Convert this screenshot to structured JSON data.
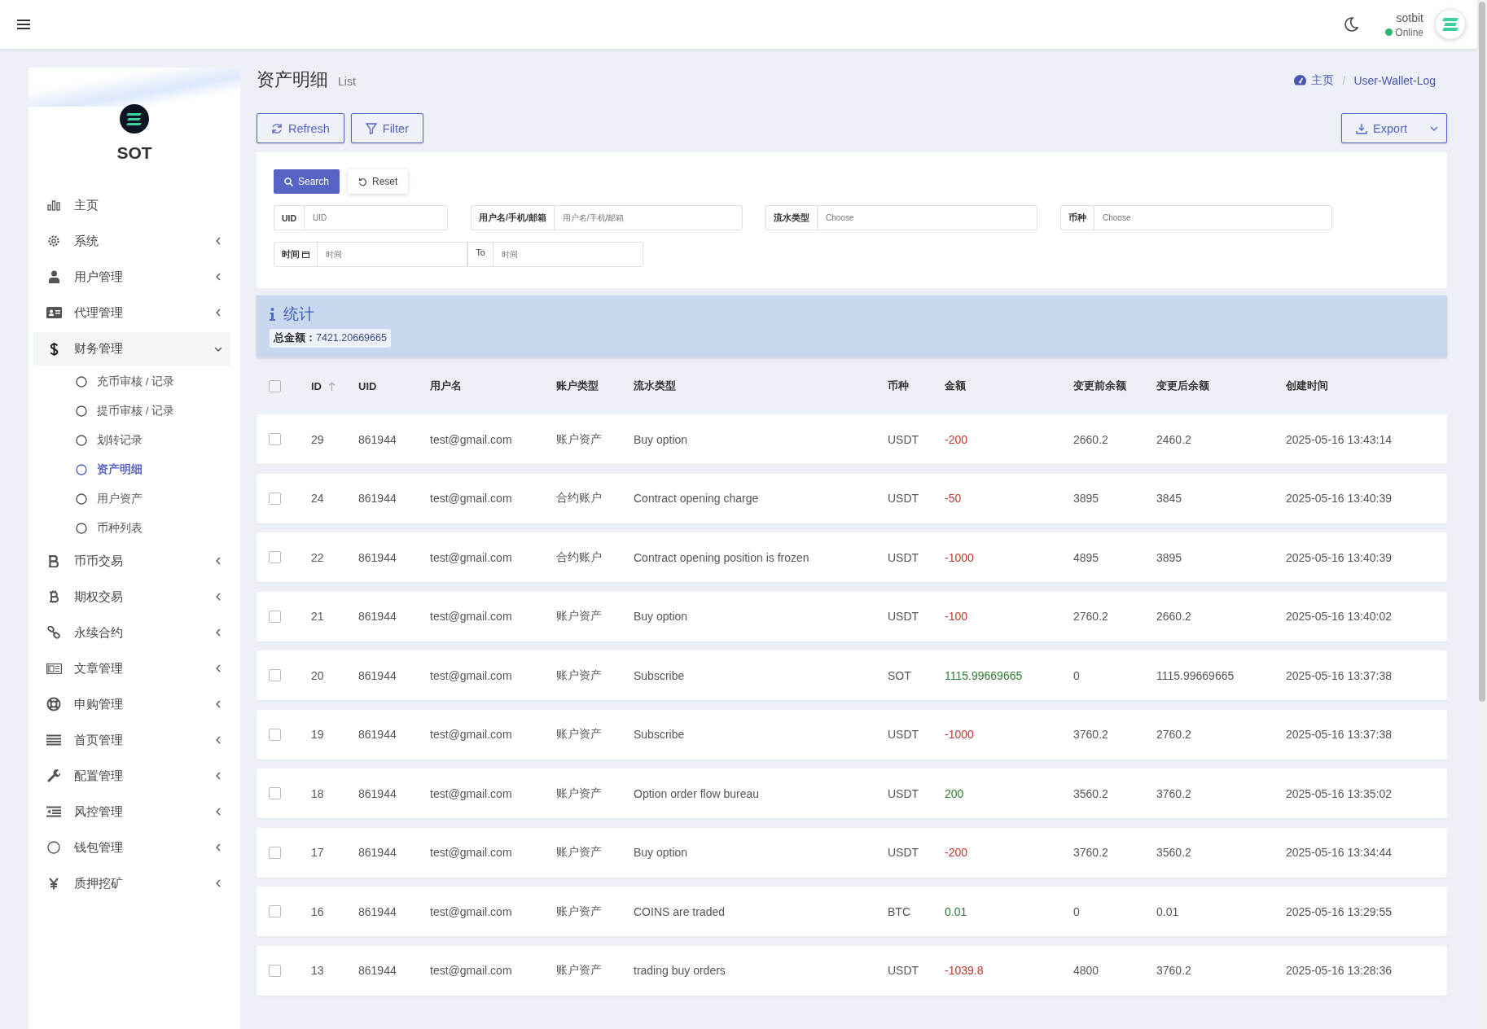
{
  "header": {
    "user": {
      "name": "sotbit",
      "status": "Online"
    }
  },
  "sidebar": {
    "brand": "SOT",
    "items": [
      {
        "label": "主页",
        "expanded": false
      },
      {
        "label": "系统",
        "expanded": false
      },
      {
        "label": "用户管理",
        "expanded": false
      },
      {
        "label": "代理管理",
        "expanded": false
      },
      {
        "label": "财务管理",
        "expanded": true,
        "children": [
          {
            "label": "充币审核 / 记录",
            "selected": false
          },
          {
            "label": "提币审核 / 记录",
            "selected": false
          },
          {
            "label": "划转记录",
            "selected": false
          },
          {
            "label": "资产明细",
            "selected": true
          },
          {
            "label": "用户资产",
            "selected": false
          },
          {
            "label": "币种列表",
            "selected": false
          }
        ]
      },
      {
        "label": "币币交易",
        "expanded": false
      },
      {
        "label": "期权交易",
        "expanded": false
      },
      {
        "label": "永续合约",
        "expanded": false
      },
      {
        "label": "文章管理",
        "expanded": false
      },
      {
        "label": "申购管理",
        "expanded": false
      },
      {
        "label": "首页管理",
        "expanded": false
      },
      {
        "label": "配置管理",
        "expanded": false
      },
      {
        "label": "风控管理",
        "expanded": false
      },
      {
        "label": "钱包管理",
        "expanded": false
      },
      {
        "label": "质押挖矿",
        "expanded": false
      }
    ]
  },
  "page": {
    "title": "资产明细",
    "subtitle": "List",
    "breadcrumb": [
      "主页",
      "User-Wallet-Log"
    ],
    "breadcrumb_separator": "/"
  },
  "toolbar": {
    "refresh": "Refresh",
    "filter": "Filter",
    "export": "Export"
  },
  "filter": {
    "search": "Search",
    "reset": "Reset",
    "fields": [
      {
        "label": "UID",
        "placeholder": "UID"
      },
      {
        "label": "用户名/手机/邮箱",
        "placeholder": "用户名/手机/邮箱"
      },
      {
        "label": "流水类型",
        "placeholder": "Choose"
      },
      {
        "label": "币种",
        "placeholder": "Choose"
      }
    ],
    "time": {
      "label": "时间",
      "from_placeholder": "时间",
      "to": "To",
      "to_placeholder": "时间"
    }
  },
  "stats": {
    "title": "统计",
    "total_label": "总金额：",
    "total": "7421.20669665"
  },
  "table": {
    "select_all_checked": false,
    "columns": [
      "ID",
      "UID",
      "用户名",
      "账户类型",
      "流水类型",
      "币种",
      "金额",
      "变更前余额",
      "变更后余额",
      "创建时间"
    ],
    "rows": [
      {
        "id": "29",
        "uid": "861944",
        "user": "test@gmail.com",
        "account": "账户资产",
        "type": "Buy option",
        "coin": "USDT",
        "amount": "-200",
        "color": "#c0392b",
        "before": "2660.2",
        "after": "2460.2",
        "time": "2025-05-16 13:43:14",
        "checked": false
      },
      {
        "id": "24",
        "uid": "861944",
        "user": "test@gmail.com",
        "account": "合约账户",
        "type": "Contract opening charge",
        "coin": "USDT",
        "amount": "-50",
        "color": "#c0392b",
        "before": "3895",
        "after": "3845",
        "time": "2025-05-16 13:40:39",
        "checked": false
      },
      {
        "id": "22",
        "uid": "861944",
        "user": "test@gmail.com",
        "account": "合约账户",
        "type": "Contract opening position is frozen",
        "coin": "USDT",
        "amount": "-1000",
        "color": "#c0392b",
        "before": "4895",
        "after": "3895",
        "time": "2025-05-16 13:40:39",
        "checked": false
      },
      {
        "id": "21",
        "uid": "861944",
        "user": "test@gmail.com",
        "account": "账户资产",
        "type": "Buy option",
        "coin": "USDT",
        "amount": "-100",
        "color": "#c0392b",
        "before": "2760.2",
        "after": "2660.2",
        "time": "2025-05-16 13:40:02",
        "checked": false
      },
      {
        "id": "20",
        "uid": "861944",
        "user": "test@gmail.com",
        "account": "账户资产",
        "type": "Subscribe",
        "coin": "SOT",
        "amount": "1115.99669665",
        "color": "#2e7d32",
        "before": "0",
        "after": "1115.99669665",
        "time": "2025-05-16 13:37:38",
        "checked": false
      },
      {
        "id": "19",
        "uid": "861944",
        "user": "test@gmail.com",
        "account": "账户资产",
        "type": "Subscribe",
        "coin": "USDT",
        "amount": "-1000",
        "color": "#c0392b",
        "before": "3760.2",
        "after": "2760.2",
        "time": "2025-05-16 13:37:38",
        "checked": false
      },
      {
        "id": "18",
        "uid": "861944",
        "user": "test@gmail.com",
        "account": "账户资产",
        "type": "Option order flow bureau",
        "coin": "USDT",
        "amount": "200",
        "color": "#2e7d32",
        "before": "3560.2",
        "after": "3760.2",
        "time": "2025-05-16 13:35:02",
        "checked": false
      },
      {
        "id": "17",
        "uid": "861944",
        "user": "test@gmail.com",
        "account": "账户资产",
        "type": "Buy option",
        "coin": "USDT",
        "amount": "-200",
        "color": "#c0392b",
        "before": "3760.2",
        "after": "3560.2",
        "time": "2025-05-16 13:34:44",
        "checked": false
      },
      {
        "id": "16",
        "uid": "861944",
        "user": "test@gmail.com",
        "account": "账户资产",
        "type": "COINS are traded",
        "coin": "BTC",
        "amount": "0.01",
        "color": "#2e7d32",
        "before": "0",
        "after": "0.01",
        "time": "2025-05-16 13:29:55",
        "checked": false
      },
      {
        "id": "13",
        "uid": "861944",
        "user": "test@gmail.com",
        "account": "账户资产",
        "type": "trading buy orders",
        "coin": "USDT",
        "amount": "-1039.8",
        "color": "#c0392b",
        "before": "4800",
        "after": "3760.2",
        "time": "2025-05-16 13:28:36",
        "checked": false
      }
    ]
  }
}
